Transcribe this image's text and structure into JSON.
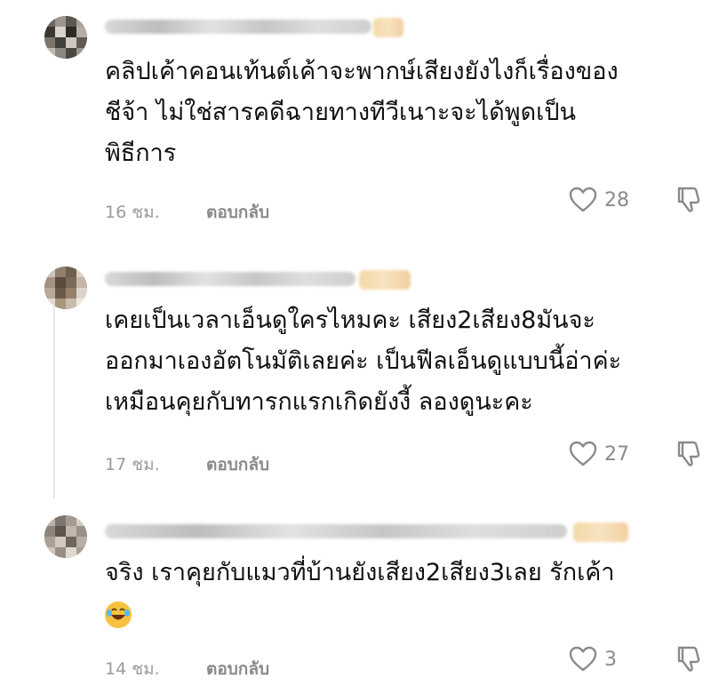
{
  "comments": [
    {
      "text_lines": [
        "คลิปเค้าคอนเท้นต์เค้าจะพากษ์เสียงยังไงก็เรื่องของ",
        "ชีจ้า ไม่ใช่สารคดีฉายทางทีวีเนาะจะได้พูดเป็น",
        "พิธีการ"
      ],
      "time": "16 ชม.",
      "reply_label": "ตอบกลับ",
      "likes": "28"
    },
    {
      "text_lines": [
        "เคยเป็นเวลาเอ็นดูใครไหมคะ เสียง2เสียง8มันจะ",
        "ออกมาเองอัตโนมัติเลยค่ะ เป็นฟีลเอ็นดูแบบนี้อ่าค่ะ",
        "เหมือนคุยกับทารกแรกเกิดยังงี้ ลองดูนะคะ"
      ],
      "time": "17 ชม.",
      "reply_label": "ตอบกลับ",
      "likes": "27"
    },
    {
      "text_lines": [
        "จริง เราคุยกับแมวที่บ้านยังเสียง2เสียง3เลย รักเค้า"
      ],
      "time": "14 ชม.",
      "reply_label": "ตอบกลับ",
      "likes": "3",
      "emoji": "laughing-face-emoji"
    }
  ],
  "colors": {
    "text": "#111111",
    "meta": "#9a9a9a",
    "icon": "#8a8a8a",
    "emoji_yellow": "#f6c23e"
  },
  "icons": {
    "like": "heart-outline-icon",
    "dislike": "thumbs-down-outline-icon"
  }
}
